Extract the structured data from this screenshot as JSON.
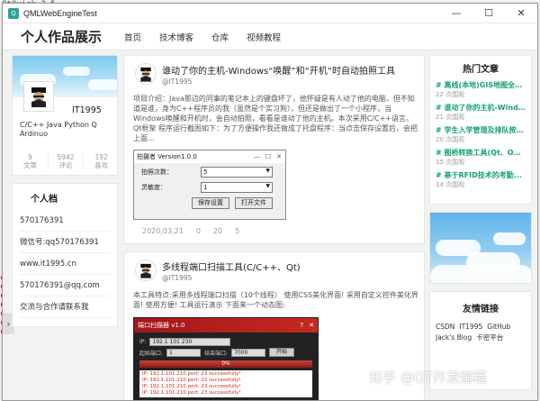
{
  "background": {
    "top_text": "QtQuick 2.5"
  },
  "window": {
    "title": "QMLWebEngineTest",
    "minimize": "—",
    "maximize": "☐",
    "close": "✕"
  },
  "header": {
    "brand": "个人作品展示",
    "nav": [
      "首页",
      "技术博客",
      "仓库",
      "视频教程"
    ]
  },
  "profile": {
    "name": "IT1995",
    "bio": "C/C++ Java Python Q Ardinuo",
    "stats": [
      {
        "value": "9",
        "label": "文章"
      },
      {
        "value": "5942",
        "label": "评论"
      },
      {
        "value": "192",
        "label": "喜欢"
      }
    ]
  },
  "personal": {
    "title": "个人档",
    "items": [
      "570176391",
      "微信号:qq570176391",
      "www.it1995.cn",
      "570176391@qq.com",
      "交流与合作请联系我"
    ]
  },
  "posts": [
    {
      "title": "谁动了你的主机-Windows“唤醒”和“开机”时自动拍照工具",
      "author": "@IT1995",
      "body": "项目介绍：Java那边的同事的笔记本上的键盘坏了，他怀疑是有人动了他的电脑，但不知道是谁，身为C++程序员的我（虽然是个实习狗），但还是做出了一个小程序，当Windows唤醒和开机时，会自动拍照，看看是谁动了他的主机。本次采用C/C++语言。Qt框架 程序运行截图如下：为了方便操作我还做成了托盘程序：当点击保存设置后，会把上面...",
      "dialog": {
        "title": "拍摄者 Version1.0.0",
        "ctrls": [
          "—",
          "☐",
          "✕"
        ],
        "fields": [
          {
            "label": "拍照次数：",
            "value": "5"
          },
          {
            "label": "灵敏度：",
            "value": "1"
          }
        ],
        "buttons": [
          "保存设置",
          "打开文件"
        ]
      },
      "meta": {
        "date": "2020,03,21",
        "views": "0",
        "likes": "20",
        "comments": "5"
      }
    },
    {
      "title": "多线程端口扫描工具(C/C++、Qt)",
      "author": "@IT1995",
      "body": "本工具特点:采用多线程端口扫描（10个线程） 使用CSS美化界面! 采用自定义控件美化界面! 使用方便! 工具运行演示 下面来一个动态图:",
      "scanner": {
        "title": "端口扫描器 v1.0",
        "ctrls": [
          "?",
          "✕"
        ],
        "ip_label": "IP:",
        "ip_value": "192.1 101 230",
        "start_label": "起始端口:",
        "start_value": "1",
        "end_label": "结束端口:",
        "end_value": "7000",
        "button": "开始",
        "progress": "0%",
        "log": [
          "IP: 192.1.101.210 port: 23 successfully!",
          "IP: 192.1.101.210 port: 22 successfully!",
          "IP: 192.1.101.210 port: 23 successfully!",
          "IP: 192.1.101.210 port: 23 successfully!"
        ]
      }
    }
  ],
  "hot": {
    "title": "热门文章",
    "items": [
      {
        "title": "# 离线(本地)GIS地图全自动化...",
        "views": "22 次围观"
      },
      {
        "title": "# 谁动了你的主机-Windows“唤醒”...",
        "views": "21 次围观"
      },
      {
        "title": "# 学生入学管理及排队按钮...",
        "views": "20 次围观"
      },
      {
        "title": "# 图桥转换工具(Qt、OpenCV)...",
        "views": "15 次围观"
      },
      {
        "title": "# 基于RFID技术的考勤...",
        "views": "14 次围观"
      }
    ]
  },
  "friends": {
    "title": "友情链接",
    "links": [
      "CSDN",
      "IT1995",
      "GitHub",
      "Jack's Blog",
      "卡密平台"
    ]
  },
  "watermark": "知乎 @QT开发编程"
}
